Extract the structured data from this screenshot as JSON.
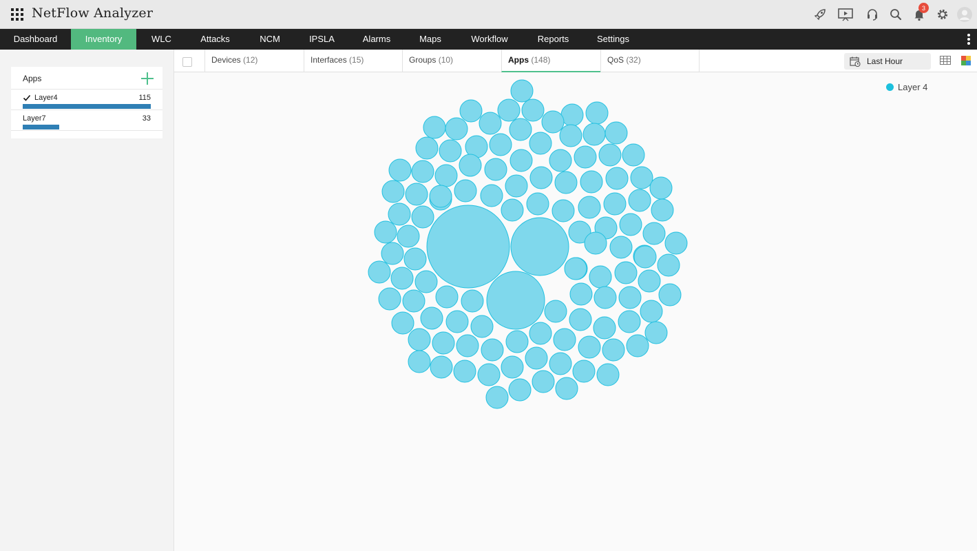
{
  "header": {
    "title": "NetFlow Analyzer",
    "notification_count": "3",
    "icons": [
      "rocket-icon",
      "presentation-icon",
      "headset-icon",
      "search-icon",
      "bell-icon",
      "gear-icon",
      "user-avatar-icon"
    ]
  },
  "nav": {
    "items": [
      {
        "label": "Dashboard"
      },
      {
        "label": "Inventory"
      },
      {
        "label": "WLC"
      },
      {
        "label": "Attacks"
      },
      {
        "label": "NCM"
      },
      {
        "label": "IPSLA"
      },
      {
        "label": "Alarms"
      },
      {
        "label": "Maps"
      },
      {
        "label": "Workflow"
      },
      {
        "label": "Reports"
      },
      {
        "label": "Settings"
      }
    ],
    "active": "Inventory"
  },
  "sidebar": {
    "title": "Apps",
    "items": [
      {
        "label": "Layer4",
        "count": "115",
        "selected": true,
        "fraction": 1.0
      },
      {
        "label": "Layer7",
        "count": "33",
        "selected": false,
        "fraction": 0.287
      }
    ]
  },
  "tabs": [
    {
      "label": "Devices",
      "count": "(12)"
    },
    {
      "label": "Interfaces",
      "count": "(15)"
    },
    {
      "label": "Groups",
      "count": "(10)"
    },
    {
      "label": "Apps",
      "count": "(148)"
    },
    {
      "label": "QoS",
      "count": "(32)"
    }
  ],
  "active_tab": "Apps",
  "time_range": "Last Hour",
  "view_icons": [
    "table-view-icon",
    "heatmap-view-icon"
  ],
  "legend": {
    "label": "Layer 4",
    "color": "#1cc0dd"
  },
  "colors": {
    "accent": "#4fc08d",
    "bubble_fill": "#7fd8ec",
    "bubble_stroke": "#22c0e0",
    "bar": "#2f7fb5",
    "navbar": "#222222"
  },
  "chart_data": {
    "type": "bubble-cluster",
    "series": [
      {
        "name": "Layer 4",
        "count": 115
      }
    ],
    "large_bubbles": 3
  }
}
